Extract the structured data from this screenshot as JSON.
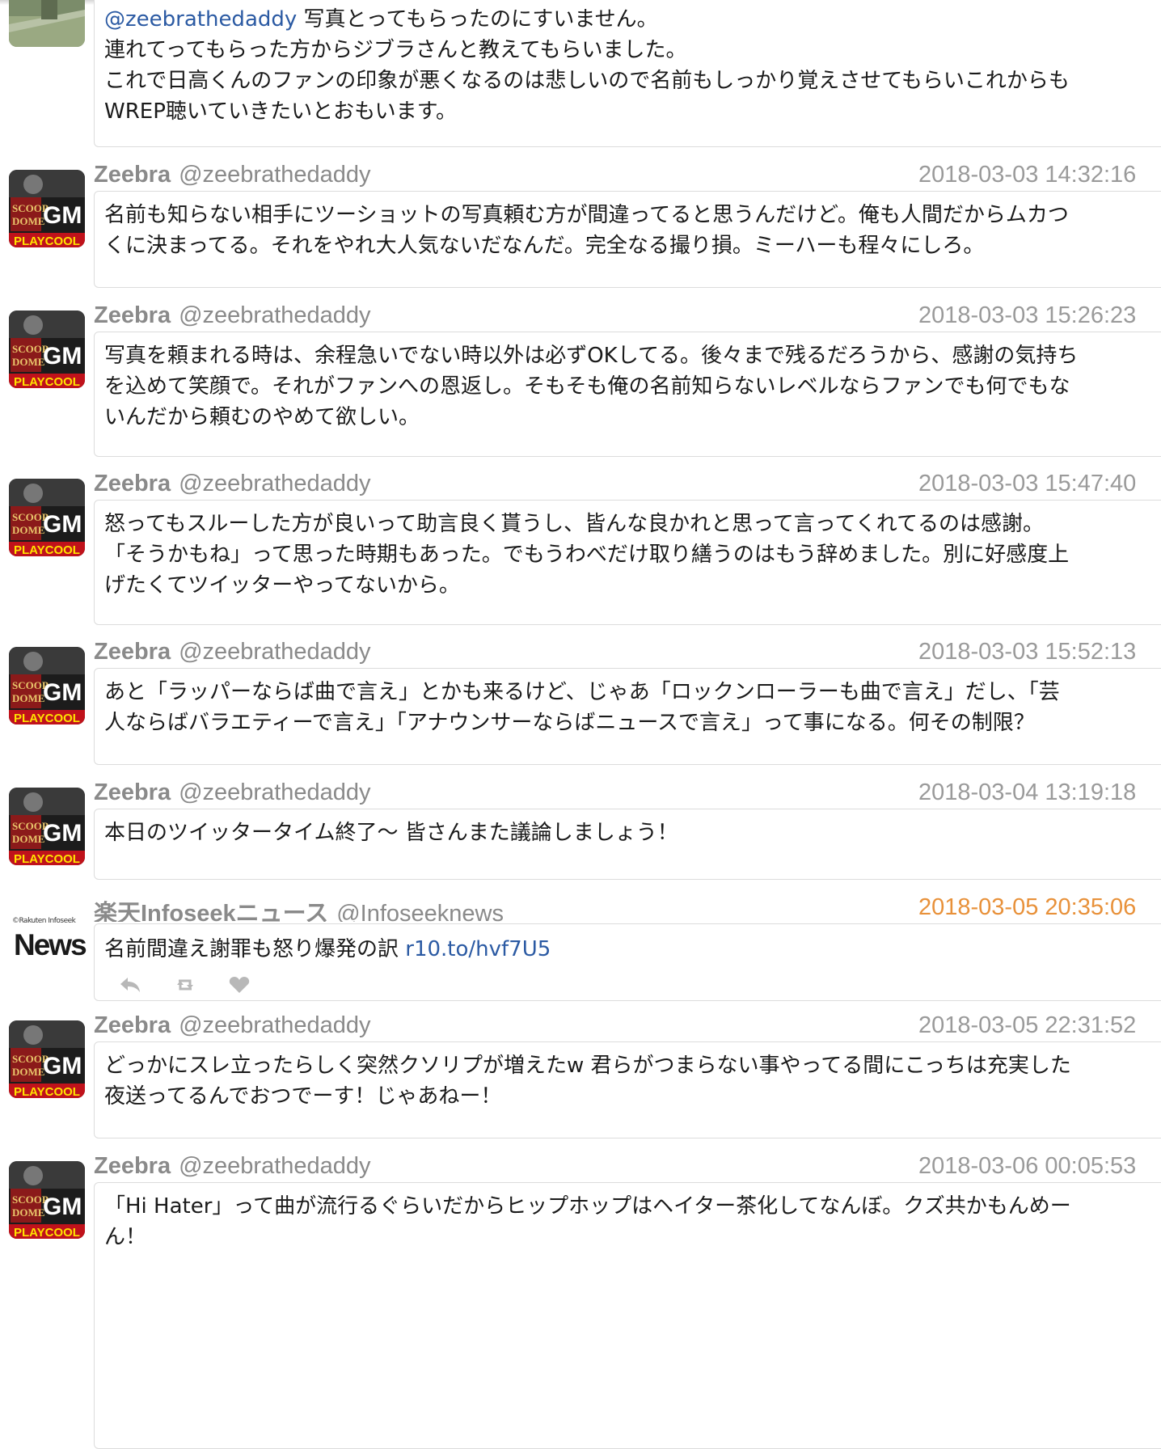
{
  "tweets": [
    {
      "mention": "@zeebrathedaddy",
      "lines": [
        " 写真とってもらったのにすいません。",
        "連れてってもらった方からジブラさんと教えてもらいました。",
        "これで日高くんのファンの印象が悪くなるのは悲しいので名前もしっかり覚えさせてもらいこれからも",
        "WREP聴いていきたいとおもいます。"
      ]
    },
    {
      "name": "Zeebra",
      "handle": "@zeebrathedaddy",
      "timestamp": "2018-03-03 14:32:16",
      "lines": [
        "名前も知らない相手にツーショットの写真頼む方が間違ってると思うんだけど。俺も人間だからムカつ",
        "くに決まってる。それをやれ大人気ないだなんだ。完全なる撮り損。ミーハーも程々にしろ。"
      ]
    },
    {
      "name": "Zeebra",
      "handle": "@zeebrathedaddy",
      "timestamp": "2018-03-03 15:26:23",
      "lines": [
        "写真を頼まれる時は、余程急いでない時以外は必ずOKしてる。後々まで残るだろうから、感謝の気持ち",
        "を込めて笑顔で。それがファンへの恩返し。そもそも俺の名前知らないレベルならファンでも何でもな",
        "いんだから頼むのやめて欲しい。"
      ]
    },
    {
      "name": "Zeebra",
      "handle": "@zeebrathedaddy",
      "timestamp": "2018-03-03 15:47:40",
      "lines": [
        "怒ってもスルーした方が良いって助言良く貰うし、皆んな良かれと思って言ってくれてるのは感謝。",
        "「そうかもね」って思った時期もあった。でもうわべだけ取り繕うのはもう辞めました。別に好感度上",
        "げたくてツイッターやってないから。"
      ]
    },
    {
      "name": "Zeebra",
      "handle": "@zeebrathedaddy",
      "timestamp": "2018-03-03 15:52:13",
      "lines": [
        "あと「ラッパーならば曲で言え」とかも来るけど、じゃあ「ロックンローラーも曲で言え」だし、「芸",
        "人ならばバラエティーで言え」「アナウンサーならばニュースで言え」って事になる。何その制限？"
      ]
    },
    {
      "name": "Zeebra",
      "handle": "@zeebrathedaddy",
      "timestamp": "2018-03-04 13:19:18",
      "lines": [
        "本日のツイッタータイム終了〜 皆さんまた議論しましょう！"
      ]
    },
    {
      "name": "楽天Infoseekニュース",
      "handle": "@Infoseeknews",
      "timestamp": "2018-03-05 20:35:06",
      "text": "名前間違え謝罪も怒り爆発の訳 ",
      "link": "r10.to/hvf7U5",
      "avatar_brand": "©Rakuten Infoseek",
      "avatar_label": "News"
    },
    {
      "name": "Zeebra",
      "handle": "@zeebrathedaddy",
      "timestamp": "2018-03-05 22:31:52",
      "lines": [
        "どっかにスレ立ったらしく突然クソリプが増えたw 君らがつまらない事やってる間にこっちは充実した",
        "夜送ってるんでおつでーす！じゃあねー！"
      ]
    },
    {
      "name": "Zeebra",
      "handle": "@zeebrathedaddy",
      "timestamp": "2018-03-06 00:05:53",
      "lines": [
        "「Hi Hater」って曲が流行るぐらいだからヒップホップはヘイター茶化してなんぼ。クズ共かもんめー",
        "ん！"
      ]
    }
  ],
  "icons": {
    "reply": "reply-icon",
    "retweet": "retweet-icon",
    "like": "heart-icon"
  },
  "colors": {
    "accent_link": "#2b5aa3",
    "timestamp_highlight": "#e8913a",
    "meta_gray": "#8a8a8a"
  }
}
